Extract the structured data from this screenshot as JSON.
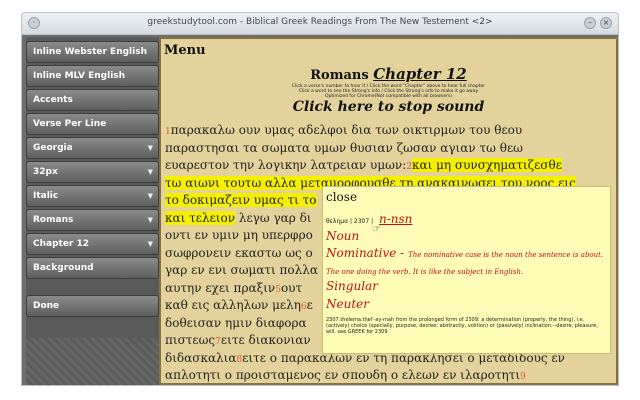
{
  "window": {
    "title": "greekstudytool.com - Biblical Greek Readings From The New Testement <2>"
  },
  "sidebar": {
    "buttons": [
      {
        "label": "Inline Webster English",
        "dropdown": false
      },
      {
        "label": "Inline MLV English",
        "dropdown": false
      },
      {
        "label": "Accents",
        "dropdown": false
      },
      {
        "label": "Verse Per Line",
        "dropdown": false
      },
      {
        "label": "Georgia",
        "dropdown": true
      },
      {
        "label": "32px",
        "dropdown": true
      },
      {
        "label": "Italic",
        "dropdown": true
      },
      {
        "label": "Romans",
        "dropdown": true
      },
      {
        "label": "Chapter 12",
        "dropdown": true
      },
      {
        "label": "Background",
        "dropdown": false
      },
      {
        "label": "Done",
        "dropdown": false
      }
    ]
  },
  "main": {
    "menu_label": "Menu",
    "book": "Romans",
    "chapter_link": "Chapter 12",
    "instructions": [
      "Click a verse's number to hear it / Click the word \"Chapter\" above to hear full chapter",
      "Click a word to see the Strong's info / Click the Strong's info to make it go away",
      "Optimized for Chrome(Not compatible with all browsers)"
    ],
    "stop_sound": "Click here to stop sound",
    "lines": [
      {
        "vn": "1",
        "text": "παρακαλω ουν υμας αδελφοι δια των οικτιρμων του θεου",
        "hl": ""
      },
      {
        "vn": "",
        "text": "παραστησαι τα σωματα υμων θυσιαν ζωσαν αγιαν τω θεω",
        "hl": ""
      },
      {
        "vn": "",
        "text": "ευαρεστον την λογικην λατρειαν υμων:",
        "vn2": "2",
        "hl": "και μη συνσχηματιζεσθε"
      },
      {
        "vn": "",
        "text": "",
        "hl": "τω αιωνι τουτω αλλα μεταμορφουσθε τη ανακαινωσει του νοος εις"
      },
      {
        "vn": "",
        "text": "",
        "hl": "το δοκιμαζειν υμας τι το"
      },
      {
        "vn": "",
        "text": " λεγω γαρ δι",
        "hl_first": "και τελειον"
      },
      {
        "vn": "",
        "text": "οντι εν υμιν μη υπερφρο",
        "hl": ""
      },
      {
        "vn": "",
        "text": "σωφρονειν εκαστω ως ο",
        "hl": ""
      },
      {
        "vn": "",
        "text": "γαρ εν ενι σωματι πολλα",
        "hl": ""
      },
      {
        "vn": "",
        "text": "αυτην εχει πραξιν",
        "vn2": "5",
        "hl": "",
        "tail": "ουτ"
      },
      {
        "vn": "",
        "text": "καθ εις αλληλων μελη",
        "vn2": "6",
        "hl": "",
        "tail": "ε"
      },
      {
        "vn": "",
        "text": "δοθεισαν ημιν διαφορα",
        "hl": ""
      },
      {
        "vn": "",
        "text": "πιστεως",
        "vn2": "7",
        "hl": "",
        "tail": "ειτε διακονιαν"
      },
      {
        "vn": "",
        "text": "διδασκαλια",
        "vn2": "8",
        "hl": "",
        "tail": "ειτε ο παρακαλων εν τη παρακλησει ο μεταδιδους εν"
      },
      {
        "vn": "",
        "text": "απλοτητι ο προισταμενος εν σπουδη ο ελεων εν ιλαροτητι",
        "vn2": "9",
        "hl": "",
        "tail": ""
      }
    ]
  },
  "popup": {
    "close": "close",
    "word": "θελημα",
    "strongs": "2307",
    "parse": "n-nsn",
    "pos": "Noun",
    "case": "Nominative - ",
    "case_desc": "The nominative case is the noun the sentence is about. The one doing the verb. It is like the subject in English.",
    "number": "Singular",
    "gender": "Neuter",
    "definition": "2307.thelema.thel'-ay-mah from the prolonged form of 2309; a determination (properly, the thing), i.e. (actively) choice (specially, purpose, decree; abstractly, volition) or (passively) inclination:--desire, pleasure, will. see GREEK for 2309"
  }
}
